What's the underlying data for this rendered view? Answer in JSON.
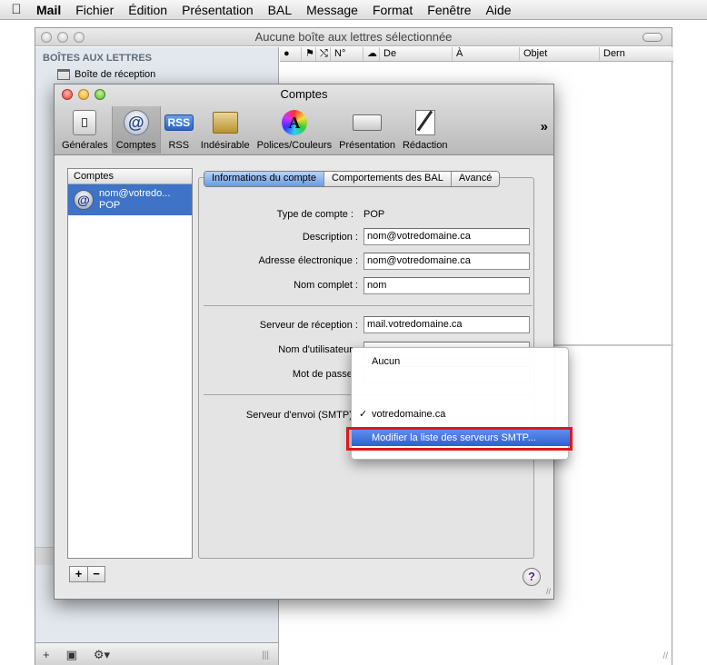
{
  "menubar": {
    "apple_icon": "apple-logo-icon",
    "app_name": "Mail",
    "items": [
      "Fichier",
      "Édition",
      "Présentation",
      "BAL",
      "Message",
      "Format",
      "Fenêtre",
      "Aide"
    ]
  },
  "mail_window": {
    "title": "Aucune boîte aux lettres sélectionnée",
    "sidebar": {
      "heading": "BOÎTES AUX LETTRES",
      "inbox_label": "Boîte de réception",
      "bottom_buttons": [
        "+",
        "▣",
        "⚙▾"
      ],
      "grip": "|||"
    },
    "columns": [
      "●",
      "⚑",
      "⤭",
      "N°",
      "☁",
      "De",
      "À",
      "Objet",
      "Dern"
    ]
  },
  "prefs_window": {
    "title": "Comptes",
    "toolbar": {
      "items": [
        {
          "label": "Générales",
          "icon": "switch-icon"
        },
        {
          "label": "Comptes",
          "icon": "at-sign-icon"
        },
        {
          "label": "RSS",
          "icon": "rss-icon"
        },
        {
          "label": "Indésirable",
          "icon": "junk-mail-icon"
        },
        {
          "label": "Polices/Couleurs",
          "icon": "font-colors-icon"
        },
        {
          "label": "Présentation",
          "icon": "viewing-icon"
        },
        {
          "label": "Rédaction",
          "icon": "composing-icon"
        }
      ],
      "overflow": "»",
      "rss_badge": "RSS",
      "at_glyph": "@",
      "font_glyph": "A"
    },
    "accounts": {
      "header": "Comptes",
      "rows": [
        {
          "name": "nom@votredo...",
          "type": "POP"
        }
      ],
      "add_label": "+",
      "remove_label": "−"
    },
    "tabs": [
      "Informations du compte",
      "Comportements des BAL",
      "Avancé"
    ],
    "form": {
      "type_label": "Type de compte :",
      "type_value": "POP",
      "description_label": "Description :",
      "description_value": "nom@votredomaine.ca",
      "email_label": "Adresse électronique :",
      "email_value": "nom@votredomaine.ca",
      "fullname_label": "Nom complet :",
      "fullname_value": "nom",
      "incoming_label": "Serveur de réception :",
      "incoming_value": "mail.votredomaine.ca",
      "username_label": "Nom d'utilisateur :",
      "password_label": "Mot de passe :",
      "smtp_label": "Serveur d'envoi (SMTP) :"
    },
    "help_label": "?"
  },
  "smtp_popup": {
    "option_none": "Aucun",
    "checkmark": "✓",
    "option_current": "votredomaine.ca",
    "option_edit": "Modifier la liste des serveurs SMTP...",
    "highlight_color": "#e0161c"
  }
}
